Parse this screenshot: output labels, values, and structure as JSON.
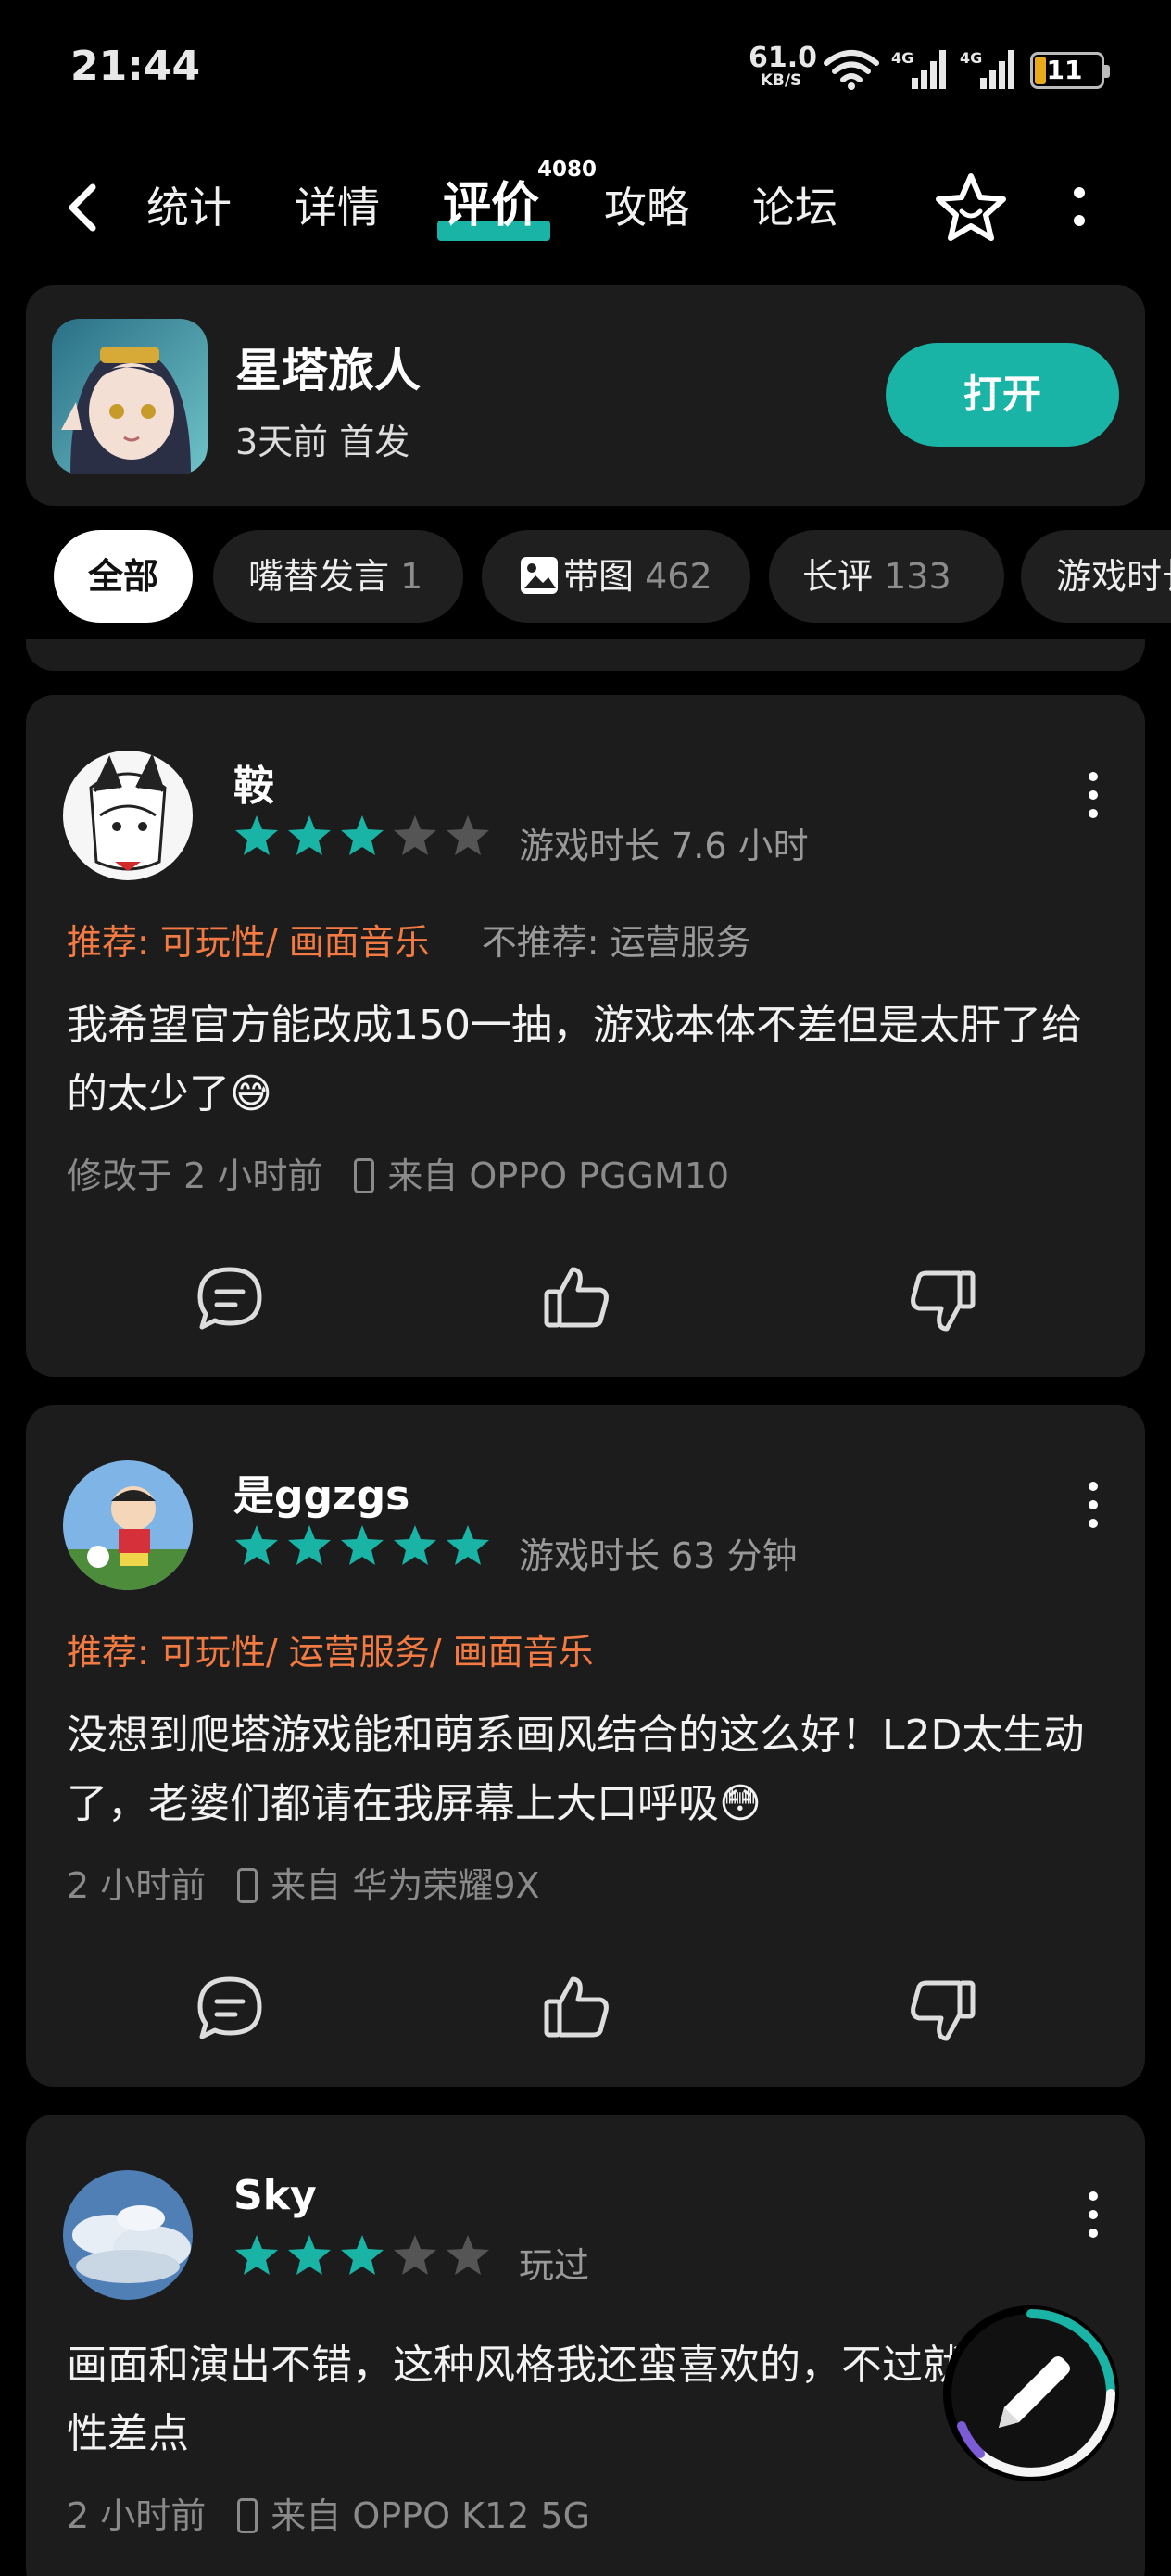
{
  "status_bar": {
    "time": "21:44",
    "net_speed": "61.0",
    "net_unit": "KB/S",
    "signal1_label": "4G",
    "signal2_label": "4G",
    "battery": "11"
  },
  "nav": {
    "tabs": [
      {
        "label": "统计"
      },
      {
        "label": "详情"
      },
      {
        "label": "评价",
        "active": true,
        "badge": "4080"
      },
      {
        "label": "攻略"
      },
      {
        "label": "论坛"
      }
    ],
    "icons": [
      "back-icon",
      "star-icon",
      "more-vertical-icon"
    ]
  },
  "game": {
    "name": "星塔旅人",
    "subtitle": "3天前 首发",
    "open_label": "打开"
  },
  "filters": [
    {
      "label": "全部",
      "count": "",
      "active": true
    },
    {
      "label": "嘴替发言",
      "count": "1"
    },
    {
      "label": "带图",
      "count": "462",
      "icon": "image-icon"
    },
    {
      "label": "长评",
      "count": "133"
    },
    {
      "label": "游戏时长",
      "count": ""
    }
  ],
  "reviews": [
    {
      "user": "鞍",
      "rating": 3,
      "playtime": "游戏时长 7.6 小时",
      "recommend": "推荐: 可玩性/ 画面音乐",
      "not_recommend": "不推荐: 运营服务",
      "content": "我希望官方能改成150一抽，游戏本体不差但是太肝了给的太少了😅",
      "time": "修改于 2 小时前",
      "device": "来自 OPPO PGGM10"
    },
    {
      "user": "是ggzgs",
      "rating": 5,
      "playtime": "游戏时长 63 分钟",
      "recommend": "推荐: 可玩性/ 运营服务/ 画面音乐",
      "not_recommend": "",
      "content": "没想到爬塔游戏能和萌系画风结合的这么好！L2D太生动了，老婆们都请在我屏幕上大口呼吸😳",
      "time": "2 小时前",
      "device": "来自 华为荣耀9X"
    },
    {
      "user": "Sky",
      "rating": 3,
      "playtime": "玩过",
      "recommend": "",
      "not_recommend": "",
      "content": "画面和演出不错，这种风格我还蛮喜欢的，不过就是流畅性差点",
      "time": "2 小时前",
      "device": "来自 OPPO K12 5G"
    }
  ],
  "colors": {
    "accent": "#19b4a5",
    "recommend": "#f37b43",
    "star_on": "#19b4a5",
    "star_off": "#555555",
    "card_bg": "#1c1c1c"
  },
  "fab_icon": "pencil-icon"
}
